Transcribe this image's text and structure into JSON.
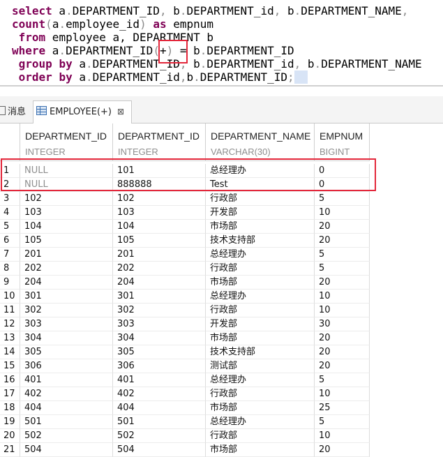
{
  "editor": {
    "lines": [
      {
        "parts": [
          {
            "t": "select",
            "k": "kw"
          },
          {
            "t": " a",
            "k": ""
          },
          {
            "t": ".",
            "k": "punct"
          },
          {
            "t": "DEPARTMENT_ID",
            "k": ""
          },
          {
            "t": ",",
            "k": "punct"
          },
          {
            "t": " b",
            "k": ""
          },
          {
            "t": ".",
            "k": "punct"
          },
          {
            "t": "DEPARTMENT_id",
            "k": ""
          },
          {
            "t": ",",
            "k": "punct"
          },
          {
            "t": " b",
            "k": ""
          },
          {
            "t": ".",
            "k": "punct"
          },
          {
            "t": "DEPARTMENT_NAME",
            "k": ""
          },
          {
            "t": ",",
            "k": "punct"
          }
        ]
      },
      {
        "parts": [
          {
            "t": "count",
            "k": "fn"
          },
          {
            "t": "(",
            "k": "punct"
          },
          {
            "t": "a",
            "k": ""
          },
          {
            "t": ".",
            "k": "punct"
          },
          {
            "t": "employee_id",
            "k": ""
          },
          {
            "t": ")",
            "k": "punct"
          },
          {
            "t": " ",
            "k": ""
          },
          {
            "t": "as",
            "k": "kw"
          },
          {
            "t": " empnum",
            "k": ""
          }
        ]
      },
      {
        "parts": [
          {
            "t": " ",
            "k": ""
          },
          {
            "t": "from",
            "k": "kw"
          },
          {
            "t": " employee a, DEPARTMENT b",
            "k": ""
          }
        ]
      },
      {
        "parts": [
          {
            "t": "where",
            "k": "kw"
          },
          {
            "t": " a",
            "k": ""
          },
          {
            "t": ".",
            "k": "punct"
          },
          {
            "t": "DEPARTMENT_ID",
            "k": ""
          },
          {
            "t": "(",
            "k": "punct"
          },
          {
            "t": "+",
            "k": ""
          },
          {
            "t": ")",
            "k": "punct"
          },
          {
            "t": " = b",
            "k": ""
          },
          {
            "t": ".",
            "k": "punct"
          },
          {
            "t": "DEPARTMENT_ID",
            "k": ""
          }
        ]
      },
      {
        "parts": [
          {
            "t": " ",
            "k": ""
          },
          {
            "t": "group",
            "k": "kw"
          },
          {
            "t": " ",
            "k": ""
          },
          {
            "t": "by",
            "k": "kw"
          },
          {
            "t": " a",
            "k": ""
          },
          {
            "t": ".",
            "k": "punct"
          },
          {
            "t": "DEPARTMENT_ID",
            "k": ""
          },
          {
            "t": ",",
            "k": "punct"
          },
          {
            "t": " b",
            "k": ""
          },
          {
            "t": ".",
            "k": "punct"
          },
          {
            "t": "DEPARTMENT_id",
            "k": ""
          },
          {
            "t": ",",
            "k": "punct"
          },
          {
            "t": " b",
            "k": ""
          },
          {
            "t": ".",
            "k": "punct"
          },
          {
            "t": "DEPARTMENT_NAME",
            "k": ""
          }
        ]
      },
      {
        "parts": [
          {
            "t": " ",
            "k": ""
          },
          {
            "t": "order",
            "k": "kw"
          },
          {
            "t": " ",
            "k": ""
          },
          {
            "t": "by",
            "k": "kw"
          },
          {
            "t": " a",
            "k": ""
          },
          {
            "t": ".",
            "k": "punct"
          },
          {
            "t": "DEPARTMENT_id",
            "k": ""
          },
          {
            "t": ",",
            "k": "punct"
          },
          {
            "t": "b",
            "k": ""
          },
          {
            "t": ".",
            "k": "punct"
          },
          {
            "t": "DEPARTMENT_ID",
            "k": ""
          },
          {
            "t": ";",
            "k": "punct"
          }
        ]
      }
    ]
  },
  "tabs": {
    "messages_label": "消息",
    "employee_label": "EMPLOYEE(+)",
    "close_symbol": "⊠"
  },
  "grid": {
    "columns": [
      {
        "name": "DEPARTMENT_ID",
        "type": "INTEGER"
      },
      {
        "name": "DEPARTMENT_ID",
        "type": "INTEGER"
      },
      {
        "name": "DEPARTMENT_NAME",
        "type": "VARCHAR(30)"
      },
      {
        "name": "EMPNUM",
        "type": "BIGINT"
      }
    ],
    "rows": [
      [
        "1",
        "NULL",
        "101",
        "总经理办",
        "0"
      ],
      [
        "2",
        "NULL",
        "888888",
        "Test",
        "0"
      ],
      [
        "3",
        "102",
        "102",
        "行政部",
        "5"
      ],
      [
        "4",
        "103",
        "103",
        "开发部",
        "10"
      ],
      [
        "5",
        "104",
        "104",
        "市场部",
        "20"
      ],
      [
        "6",
        "105",
        "105",
        "技术支持部",
        "20"
      ],
      [
        "7",
        "201",
        "201",
        "总经理办",
        "5"
      ],
      [
        "8",
        "202",
        "202",
        "行政部",
        "5"
      ],
      [
        "9",
        "204",
        "204",
        "市场部",
        "20"
      ],
      [
        "10",
        "301",
        "301",
        "总经理办",
        "10"
      ],
      [
        "11",
        "302",
        "302",
        "行政部",
        "10"
      ],
      [
        "12",
        "303",
        "303",
        "开发部",
        "30"
      ],
      [
        "13",
        "304",
        "304",
        "市场部",
        "20"
      ],
      [
        "14",
        "305",
        "305",
        "技术支持部",
        "20"
      ],
      [
        "15",
        "306",
        "306",
        "测试部",
        "20"
      ],
      [
        "16",
        "401",
        "401",
        "总经理办",
        "5"
      ],
      [
        "17",
        "402",
        "402",
        "行政部",
        "10"
      ],
      [
        "18",
        "404",
        "404",
        "市场部",
        "25"
      ],
      [
        "19",
        "501",
        "501",
        "总经理办",
        "5"
      ],
      [
        "20",
        "502",
        "502",
        "行政部",
        "10"
      ],
      [
        "21",
        "504",
        "504",
        "市场部",
        "20"
      ]
    ]
  },
  "colors": {
    "keyword": "#7f0055",
    "highlight_box": "#e3263a",
    "null_text": "#8e8e8e"
  }
}
